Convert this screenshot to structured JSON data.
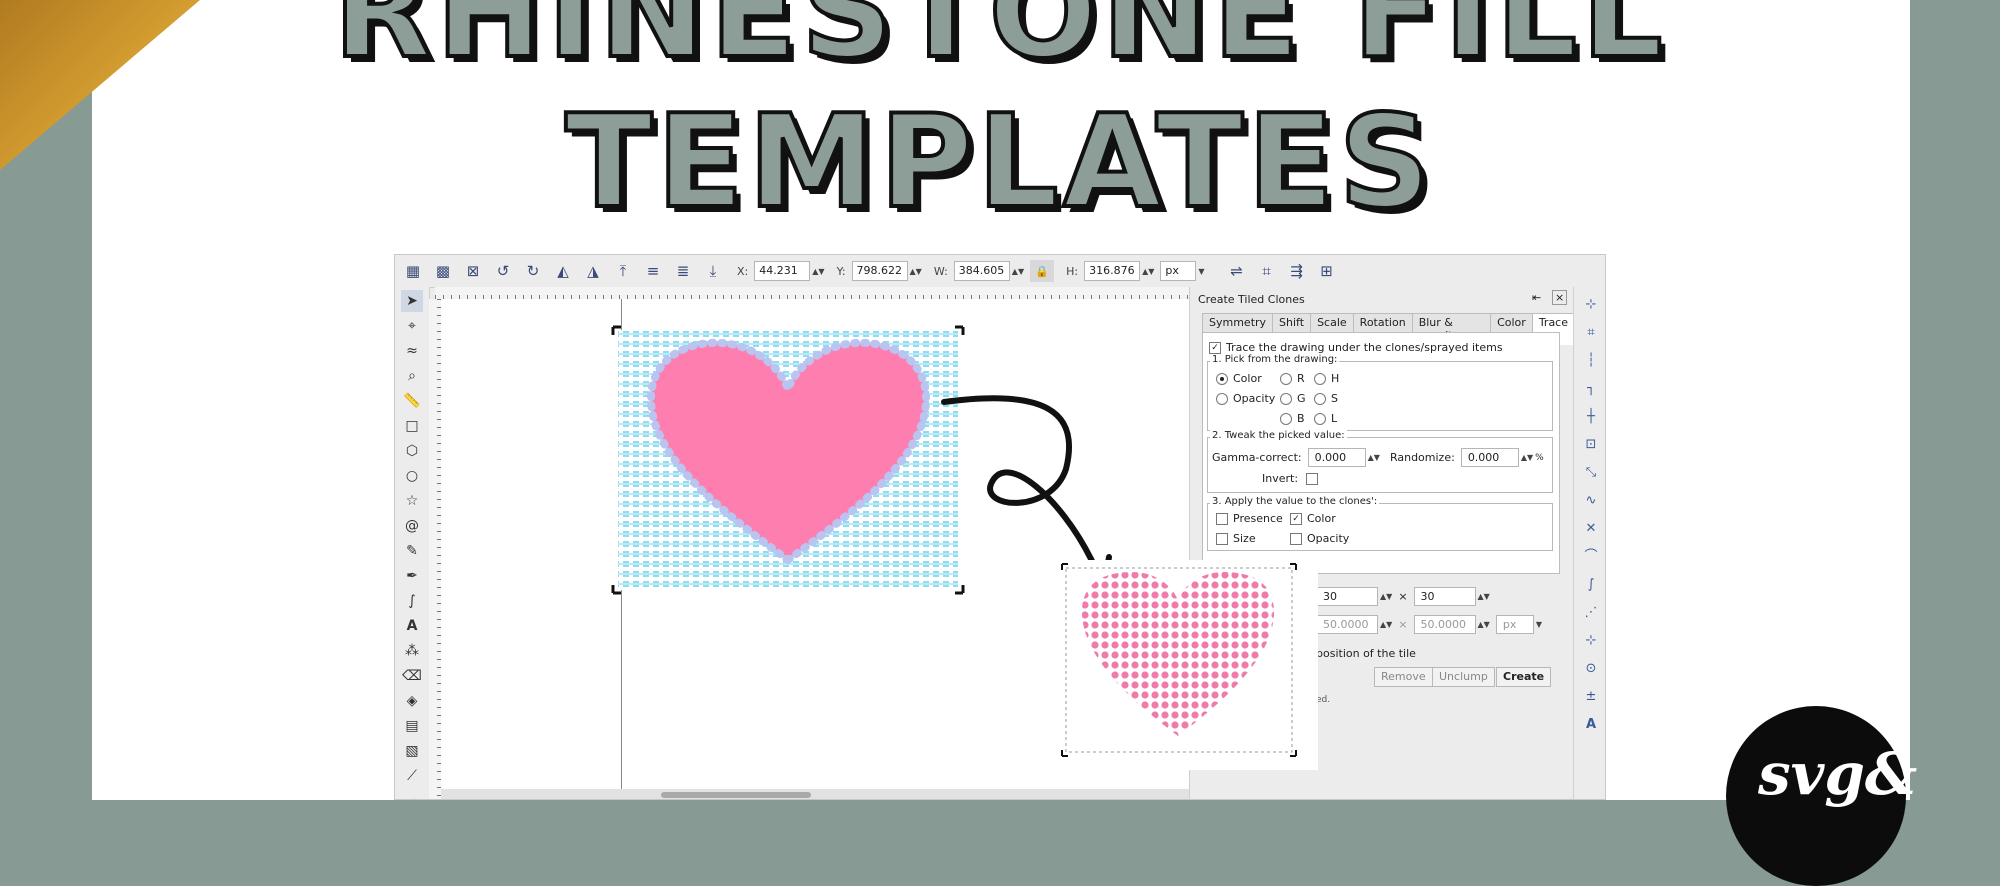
{
  "banner": {
    "title_line1": "RHINESTONE FILL",
    "title_line2": "TEMPLATES",
    "logo_text": "svg&"
  },
  "toolbar": {
    "x_label": "X:",
    "x_value": "44.231",
    "y_label": "Y:",
    "y_value": "798.622",
    "w_label": "W:",
    "w_value": "384.605",
    "h_label": "H:",
    "h_value": "316.876",
    "unit": "px"
  },
  "dialog": {
    "title": "Create Tiled Clones",
    "tabs": [
      "Symmetry",
      "Shift",
      "Scale",
      "Rotation",
      "Blur & opacity",
      "Color",
      "Trace"
    ],
    "active_tab": "Trace",
    "trace_checkbox": "Trace the drawing under the clones/sprayed items",
    "pick_group": "1. Pick from the drawing:",
    "pick_options": {
      "color": "Color",
      "opacity": "Opacity",
      "r": "R",
      "g": "G",
      "b": "B",
      "h": "H",
      "s": "S",
      "l": "L"
    },
    "tweak_group": "2. Tweak the picked value:",
    "gamma_label": "Gamma-correct:",
    "gamma_value": "0.000",
    "randomize_label": "Randomize:",
    "randomize_value": "0.000",
    "percent": "%",
    "invert_label": "Invert:",
    "apply_group": "3. Apply the value to the clones':",
    "apply_options": {
      "presence": "Presence",
      "color": "Color",
      "size": "Size",
      "opacity": "Opacity"
    },
    "rows_value": "30",
    "times": "×",
    "cols_value": "30",
    "width_value": "50.0000",
    "height_value": "50.0000",
    "size_unit": "px",
    "tile_text": "position of the tile",
    "status_text": "ed.",
    "buttons": {
      "remove": "Remove",
      "unclump": "Unclump",
      "create": "Create"
    }
  },
  "colors": {
    "heart": "#ff7eb0",
    "dots": "#f07aaa",
    "grid": "#8fdcf0",
    "background": "#879a94",
    "accent_gold": "#d9a233"
  }
}
